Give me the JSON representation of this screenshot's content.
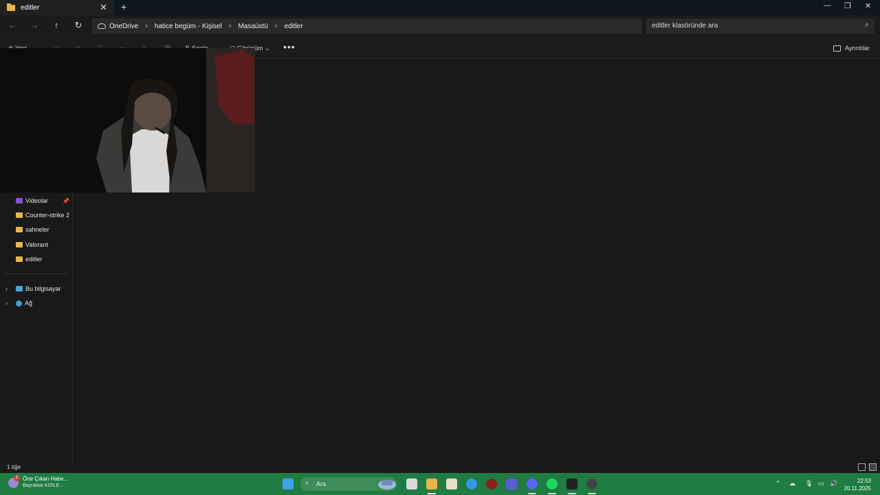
{
  "window": {
    "tab_title": "editler",
    "new_tab": "+",
    "close": "✕",
    "minimize": "—",
    "restore": "❐"
  },
  "address": {
    "back": "←",
    "forward": "→",
    "up": "↑",
    "refresh": "↻",
    "crumbs": [
      "OneDrive",
      "hatice begüm - Kişisel",
      "Masaüstü",
      "editler"
    ],
    "separator": "›",
    "search_placeholder": "editler klasöründe ara"
  },
  "commands": {
    "new": "Yeni",
    "sort": "Sırala",
    "view": "Görünüm",
    "more": "•••",
    "details": "Ayrıntılar"
  },
  "sidebar": {
    "items": [
      {
        "label": "Videolar",
        "icon": "video-folder-icon",
        "pinned": true
      },
      {
        "label": "Counter-strike 2",
        "icon": "folder-icon"
      },
      {
        "label": "sahneler",
        "icon": "folder-icon"
      },
      {
        "label": "Valorant",
        "icon": "folder-icon"
      },
      {
        "label": "editler",
        "icon": "folder-icon"
      }
    ],
    "groups": [
      {
        "label": "Bu bilgisayar",
        "icon": "computer-icon"
      },
      {
        "label": "Ağ",
        "icon": "network-icon"
      }
    ]
  },
  "status": {
    "item_count": "1 öğe"
  },
  "taskbar": {
    "news_title": "Öne Çıkan Habe...",
    "news_sub": "Bayraktar KIZILE...",
    "news_badge": "2",
    "search_label": "Ara",
    "clock_time": "22:53",
    "clock_date": "20.11.2025"
  },
  "colors": {
    "folder": "#e8b64a",
    "taskbar": "#1f7c43",
    "background": "#191919"
  }
}
